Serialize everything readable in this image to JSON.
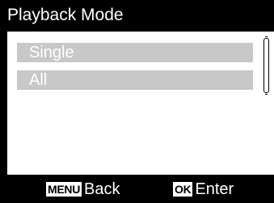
{
  "title": "Playback Mode",
  "menu": {
    "items": [
      {
        "label": "Single"
      },
      {
        "label": "All"
      }
    ]
  },
  "footer": {
    "back": {
      "key": "MENU",
      "label": "Back"
    },
    "enter": {
      "key": "OK",
      "label": "Enter"
    }
  },
  "colors": {
    "background": "#000000",
    "panel": "#ffffff",
    "item_fill": "#c8c8c8",
    "text_light": "#ffffff"
  }
}
